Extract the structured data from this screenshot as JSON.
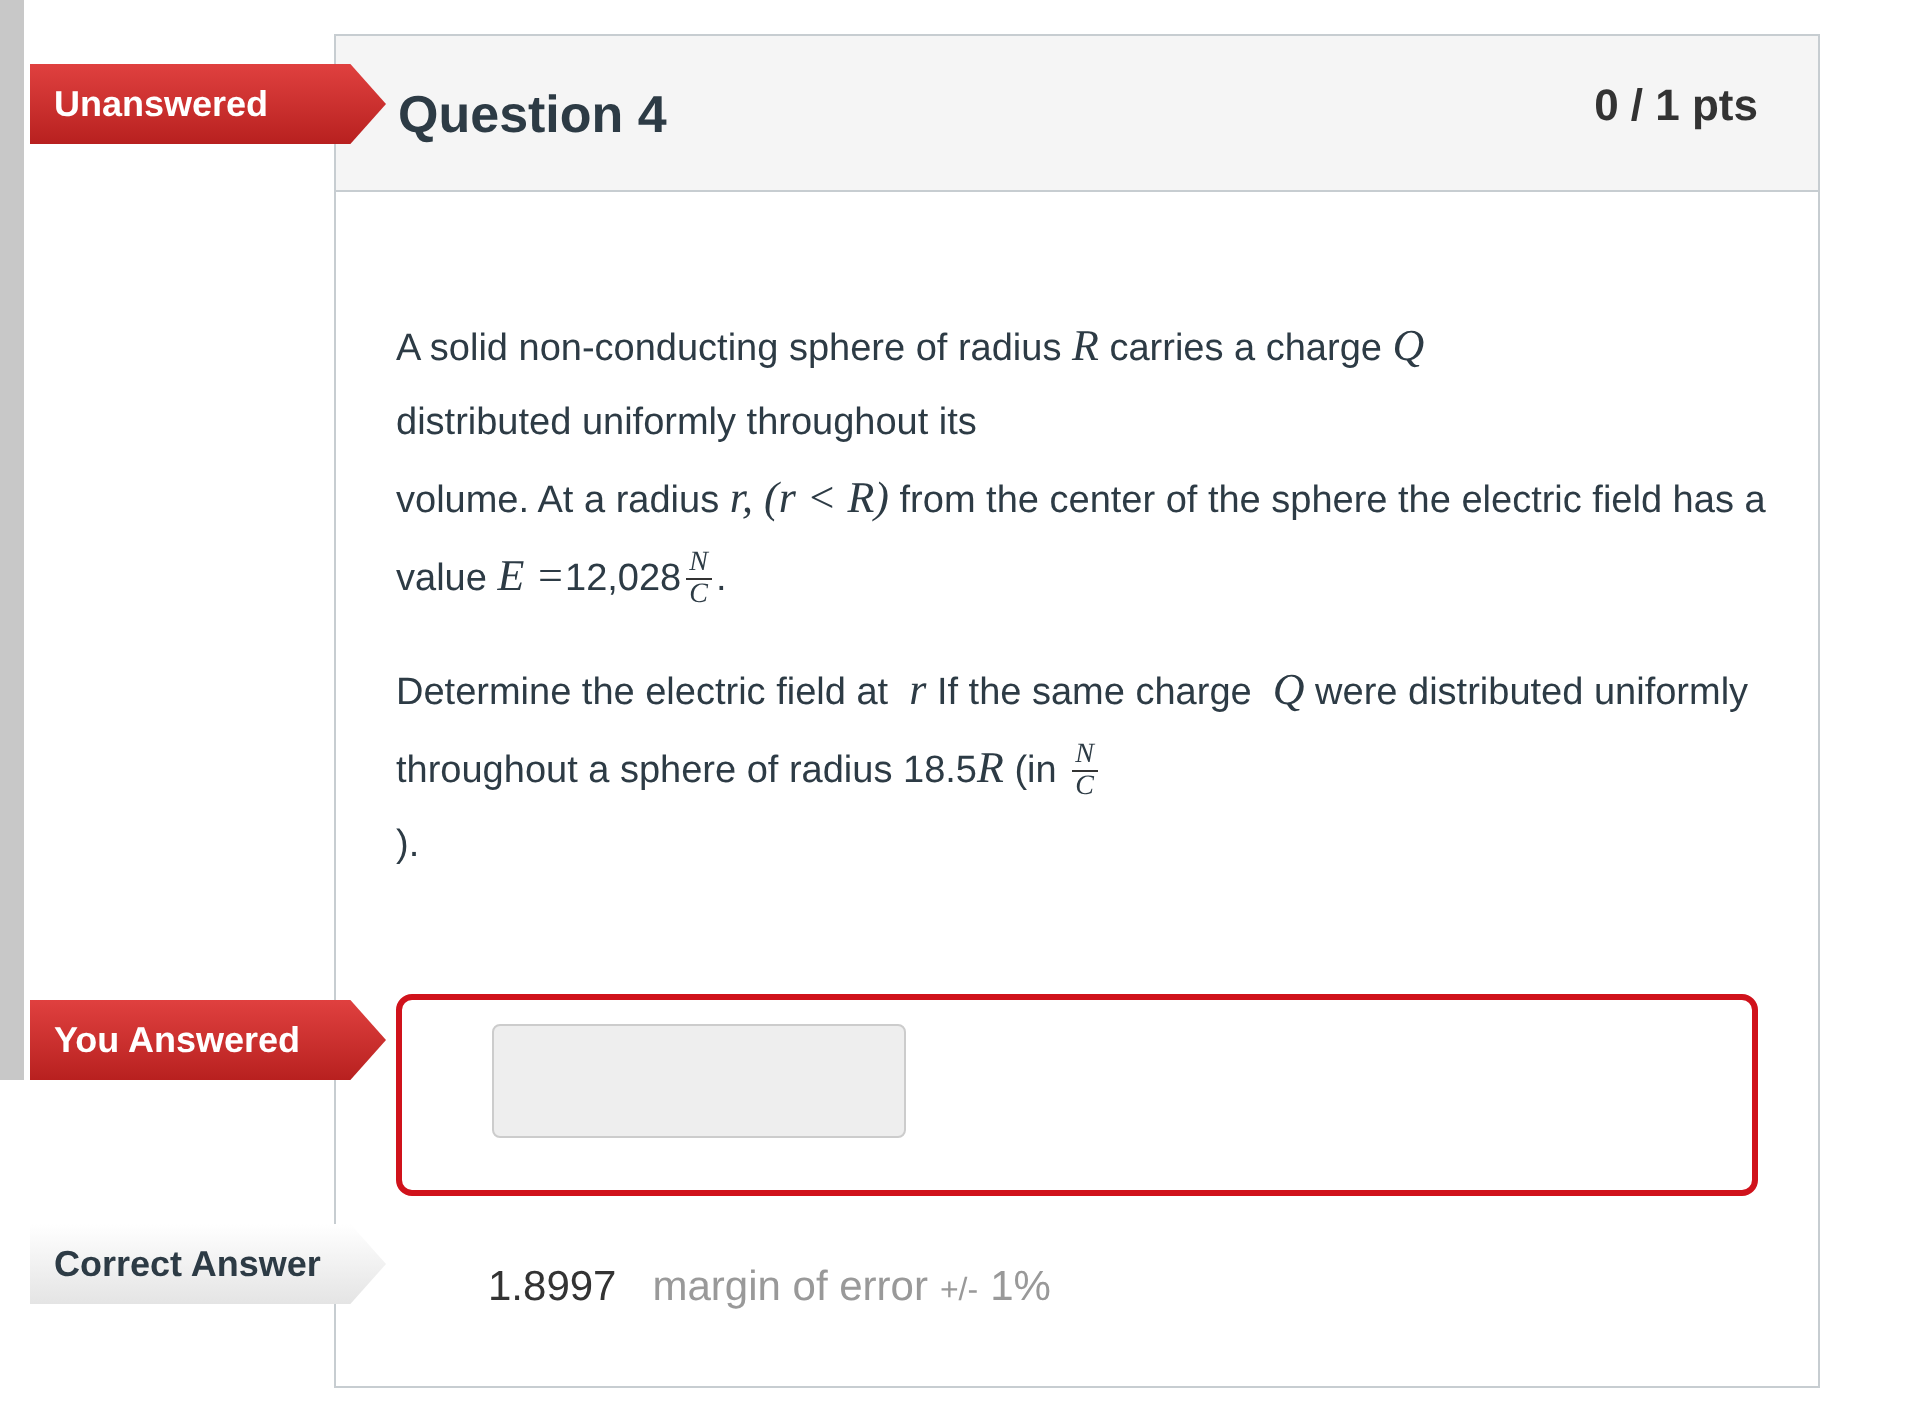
{
  "question": {
    "flag": {
      "kind": "unanswered",
      "label": "Unanswered"
    },
    "title": "Question 4",
    "points": "0 / 1 pts"
  },
  "paragraphs": [
    [
      {
        "kind": "text",
        "text": "A solid non-conducting sphere of radius "
      },
      {
        "kind": "math",
        "text": "R"
      },
      {
        "kind": "text",
        "text": " carries a charge "
      },
      {
        "kind": "math",
        "text": "Q"
      },
      {
        "kind": "break"
      },
      {
        "kind": "text",
        "text": "distributed uniformly throughout its"
      },
      {
        "kind": "break"
      },
      {
        "kind": "text",
        "text": "volume. At a radius "
      },
      {
        "kind": "math",
        "text": "r, (r < R)"
      },
      {
        "kind": "text",
        "text": " from the center of the sphere the electric field has a value "
      },
      {
        "kind": "math",
        "text": "E ="
      },
      {
        "kind": "text",
        "text": "12,028"
      },
      {
        "kind": "frac",
        "num": "N",
        "den": "C"
      },
      {
        "kind": "text",
        "text": "."
      }
    ],
    [
      {
        "kind": "text",
        "text": "Determine the electric field at  "
      },
      {
        "kind": "math",
        "text": "r"
      },
      {
        "kind": "text",
        "text": " If the same charge  "
      },
      {
        "kind": "math",
        "text": "Q"
      },
      {
        "kind": "text",
        "text": " were distributed uniformly throughout a sphere of radius 18.5"
      },
      {
        "kind": "math",
        "text": "R"
      },
      {
        "kind": "text",
        "text": " (in "
      },
      {
        "kind": "frac",
        "num": "N",
        "den": "C"
      },
      {
        "kind": "break"
      },
      {
        "kind": "text",
        "text": ")."
      }
    ]
  ],
  "your_answer": {
    "flag": {
      "kind": "you_answered",
      "label": "You Answered"
    }
  },
  "correct_answer": {
    "flag": {
      "kind": "correct",
      "label": "Correct Answer"
    },
    "value": "1.8997",
    "margin_label": "margin of error",
    "tolerance_sign": "+/-",
    "tolerance": "1%"
  }
}
